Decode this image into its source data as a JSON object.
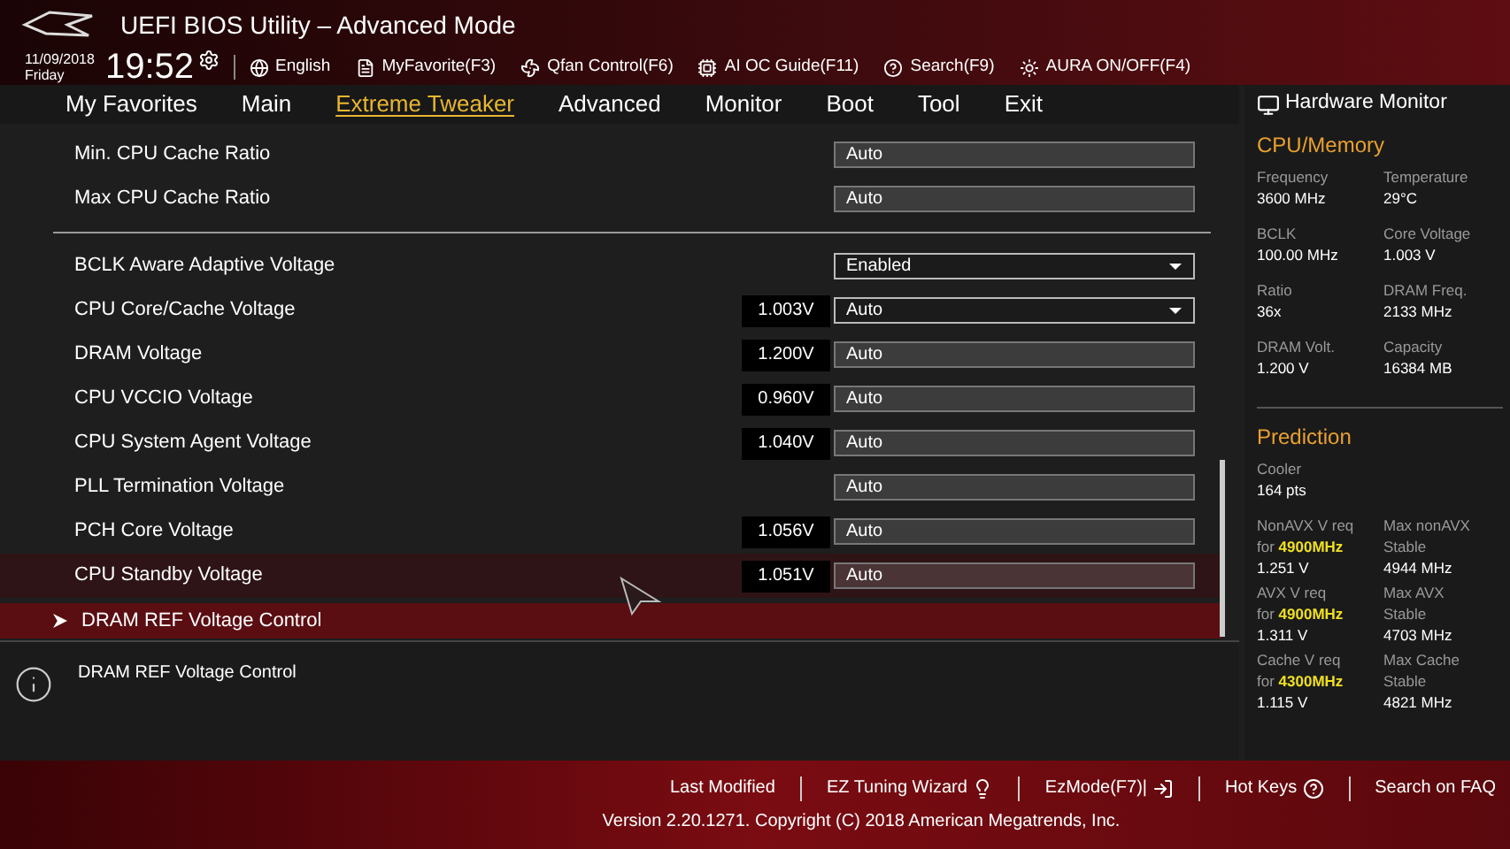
{
  "header": {
    "title": "UEFI BIOS Utility – Advanced Mode",
    "date": "11/09/2018",
    "day": "Friday",
    "time": "19:52",
    "toolbar": [
      {
        "kind": "globe",
        "label": "English"
      },
      {
        "kind": "favorite",
        "label": "MyFavorite(F3)"
      },
      {
        "kind": "fan",
        "label": "Qfan Control(F6)"
      },
      {
        "kind": "chip",
        "label": "AI OC Guide(F11)"
      },
      {
        "kind": "help",
        "label": "Search(F9)"
      },
      {
        "kind": "aura",
        "label": "AURA ON/OFF(F4)"
      }
    ]
  },
  "tabs": [
    {
      "label": "My Favorites",
      "selected": false
    },
    {
      "label": "Main",
      "selected": false
    },
    {
      "label": "Extreme Tweaker",
      "selected": true
    },
    {
      "label": "Advanced",
      "selected": false
    },
    {
      "label": "Monitor",
      "selected": false
    },
    {
      "label": "Boot",
      "selected": false
    },
    {
      "label": "Tool",
      "selected": false
    },
    {
      "label": "Exit",
      "selected": false
    }
  ],
  "settings": [
    [
      {
        "kind": "field",
        "label": "Min. CPU Cache Ratio",
        "value": "Auto",
        "hovered": false,
        "selected": false
      },
      {
        "kind": "field",
        "label": "Max CPU Cache Ratio",
        "value": "Auto",
        "hovered": false,
        "selected": false
      }
    ],
    [
      {
        "kind": "dropdown",
        "label": "BCLK Aware Adaptive Voltage",
        "value": "Enabled",
        "hovered": false,
        "selected": false
      },
      {
        "kind": "dropdown",
        "label": "CPU Core/Cache Voltage",
        "reading": "1.003V",
        "value": "Auto",
        "hovered": false,
        "selected": false
      },
      {
        "kind": "field",
        "label": "DRAM Voltage",
        "reading": "1.200V",
        "value": "Auto",
        "hovered": false,
        "selected": false
      },
      {
        "kind": "field",
        "label": "CPU VCCIO Voltage",
        "reading": "0.960V",
        "value": "Auto",
        "hovered": false,
        "selected": false
      },
      {
        "kind": "field",
        "label": "CPU System Agent Voltage",
        "reading": "1.040V",
        "value": "Auto",
        "hovered": false,
        "selected": false
      },
      {
        "kind": "field",
        "label": "PLL Termination Voltage",
        "value": "Auto",
        "hovered": false,
        "selected": false
      },
      {
        "kind": "field",
        "label": "PCH Core Voltage",
        "reading": "1.056V",
        "value": "Auto",
        "hovered": false,
        "selected": false
      },
      {
        "kind": "field",
        "label": "CPU Standby Voltage",
        "reading": "1.051V",
        "value": "Auto",
        "hovered": true,
        "selected": false
      },
      {
        "kind": "submenu",
        "label": "DRAM REF Voltage Control",
        "hovered": false,
        "selected": true
      }
    ]
  ],
  "help_text": "DRAM REF Voltage Control",
  "monitor": {
    "title": "Hardware Monitor",
    "sections": [
      {
        "title": "CPU/Memory",
        "items": [
          {
            "label": "Frequency",
            "value": "3600 MHz"
          },
          {
            "label": "Temperature",
            "value": "29°C"
          },
          {
            "label": "BCLK",
            "value": "100.00 MHz"
          },
          {
            "label": "Core Voltage",
            "value": "1.003 V"
          },
          {
            "label": "Ratio",
            "value": "36x"
          },
          {
            "label": "DRAM Freq.",
            "value": "2133 MHz"
          },
          {
            "label": "DRAM Volt.",
            "value": "1.200 V"
          },
          {
            "label": "Capacity",
            "value": "16384 MB"
          }
        ]
      },
      {
        "title": "Prediction",
        "items": [
          {
            "label": "Cooler",
            "value": "164 pts"
          },
          {
            "label": "NonAVX V req",
            "label2": "for **4900MHz**",
            "value": "1.251 V"
          },
          {
            "label": "Max nonAVX",
            "label2": "Stable",
            "value": "4944 MHz"
          },
          {
            "label": "AVX V req",
            "label2": "for **4900MHz**",
            "value": "1.311 V"
          },
          {
            "label": "Max AVX",
            "label2": "Stable",
            "value": "4703 MHz"
          },
          {
            "label": "Cache V req",
            "label2": "for **4300MHz**",
            "value": "1.115 V"
          },
          {
            "label": "Max Cache",
            "label2": "Stable",
            "value": "4821 MHz"
          }
        ]
      }
    ]
  },
  "footer": {
    "links": [
      {
        "kind": "none",
        "label": "Last Modified"
      },
      {
        "kind": "wizard",
        "label": "EZ Tuning Wizard"
      },
      {
        "kind": "exit",
        "label": "EzMode(F7)|"
      },
      {
        "kind": "help",
        "label": "Hot Keys"
      },
      {
        "kind": "none",
        "label": "Search on FAQ"
      }
    ],
    "version": "Version 2.20.1271. Copyright (C) 2018 American Megatrends, Inc."
  }
}
